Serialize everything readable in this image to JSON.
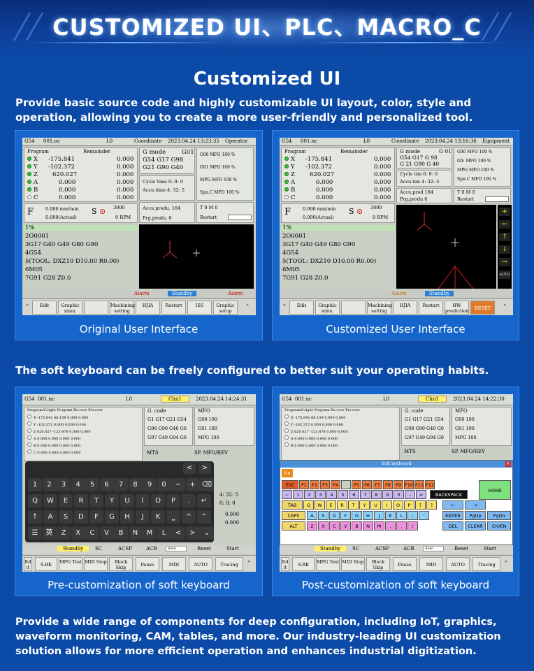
{
  "banner": {
    "title": "CUSTOMIZED UI、PLC、MACRO_C"
  },
  "section": {
    "title": "Customized UI",
    "intro": "Provide basic source code and highly customizable UI layout, color, style and operation, allowing you to create a more user-friendly and personalized tool.",
    "keyboard_text": "The soft keyboard can be freely configured to better suit your operating habits.",
    "outro": "Provide a wide range of components for deep configuration, including IoT, graphics, waveform monitoring, CAM, tables, and more. Our industry-leading UI customization solution allows for more efficient operation and enhances industrial digitization."
  },
  "cards": {
    "original": "Original User Interface",
    "customized": "Customized User Interface",
    "pre_kb": "Pre-customization of soft keyboard",
    "post_kb": "Post-customization of soft keyboard"
  },
  "screen1": {
    "top": {
      "g54": "G54",
      "file": "001.nc",
      "l0": "L0",
      "coord": "Coordinate",
      "date": "2023.04.24 13:23:35",
      "mode": "Operator"
    },
    "header": {
      "program": "Program",
      "remainder": "Remainder"
    },
    "axes": [
      {
        "name": "X",
        "val": "-175.841",
        "rem": "0.000"
      },
      {
        "name": "Y",
        "val": "-102.372",
        "rem": "0.000"
      },
      {
        "name": "Z",
        "val": "620.027",
        "rem": "0.000"
      },
      {
        "name": "A",
        "val": "0.000",
        "rem": "0.000"
      },
      {
        "name": "B",
        "val": "0.000",
        "rem": "0.000"
      },
      {
        "name": "C",
        "val": "0.000",
        "rem": "0.000"
      }
    ],
    "gmode": {
      "label": "G mode",
      "l1": "G01",
      "l2": "G54  G17  G98",
      "l3": "G21  G90  G40"
    },
    "mfo": [
      "G00 MFO  100 %",
      "G01 MFO  100 %",
      "MPG MFO  100 %",
      "Spn.C MFO  100 %"
    ],
    "cycle": "Cycle time   0: 0: 0",
    "accu": "Accu.time    4: 32: 5",
    "accu_prod": "Accu.produ.    184",
    "prg_prod": "Prg.produ.      0",
    "tmo": "T       0       M       0",
    "restart": "Restart",
    "feed": {
      "f": "F",
      "rate": "0.000 mm/min",
      "actual": "0.000(Actual)",
      "s": "S",
      "spd": "3000",
      "rpm": "0  RPM"
    },
    "program_lines": [
      "1%",
      "2O0001",
      "3G17 G40 G49 G80 G90",
      "4G54",
      "5(TOOL: DXZ10 D10.00 R0.00)",
      "6M05",
      "7G91 G28 Z0.0"
    ],
    "status": {
      "alarm1": "Alarm",
      "standby": "Standby",
      "alarm2": "Alarm"
    },
    "buttons": [
      "Edit",
      "Graphic simu.",
      "",
      "Machining setting",
      "HJIA",
      "Restart",
      "ISS",
      "Graphic setup"
    ]
  },
  "screen2": {
    "top": {
      "g54": "G54",
      "file": "001.nc",
      "l0": "L0",
      "coord": "Coordinate",
      "date": "2023.04.24 13:16:36",
      "mode": "Equipment"
    },
    "gmode": {
      "label": "G mode",
      "l1": "G 01",
      "l2": "G54  G17  G 98",
      "l3": "G 21  G90  G 40"
    },
    "mfo": [
      "G00 MFO  100 %",
      "G0: MFO  100 %",
      "MPG MFO  100 %",
      "Spn.C MFO  100 %"
    ],
    "cycle": "Cycle tim   0: 0: 0",
    "accu": "Accu.tim    4: 32: 5",
    "accu_prod": "Accu.prod     184",
    "prg_prod": "Prg.produ       0",
    "tmo": "T    0    M    0",
    "restart": "Restart",
    "status": {
      "alarm": "Alarm",
      "standby": "Standby"
    },
    "buttons": [
      "Edit",
      "Graphic simu.",
      "",
      "Machining setting",
      "HJIA",
      "Restart",
      "HW prediction",
      "RESET"
    ],
    "side_buttons": [
      "+",
      "←",
      "↑",
      "↓",
      "→",
      "AUTO"
    ]
  },
  "screen3": {
    "top": {
      "g54": "G54",
      "file": "001.nc",
      "l0": "L0",
      "chn": "Chn1",
      "date": "2023.04.24 14:24:31"
    },
    "header": "Program/G.light Program      Re.coor      Err.coor",
    "gcode": {
      "label": "G. code",
      "l1": "G1   G17  G21  G54",
      "l2": "G98  G90  G40  G0",
      "l3": "G97  G49  G94  G0"
    },
    "mfo": {
      "label": "MFO",
      "rows": [
        "G00      100",
        "G01      100",
        "MPG      100"
      ]
    },
    "mts": "MTS",
    "sp": "SP. MFO/REV",
    "keys_row1": [
      "1",
      "2",
      "3",
      "4",
      "5",
      "6",
      "7",
      "8",
      "9",
      "0",
      "−",
      "+",
      "⌫"
    ],
    "keys_row2": [
      "Q",
      "W",
      "E",
      "R",
      "T",
      "Y",
      "U",
      "I",
      "O",
      "P",
      ".",
      "↵"
    ],
    "keys_row3": [
      "↑",
      "A",
      "S",
      "D",
      "F",
      "G",
      "H",
      "J",
      "K",
      "⎵",
      "^",
      "⌃"
    ],
    "keys_row4": [
      "☰",
      "英",
      "Z",
      "X",
      "C",
      "V",
      "B",
      "N",
      "M",
      "L",
      "<",
      ">",
      "⌄"
    ],
    "status": [
      "Standby",
      "SC",
      "ACSP",
      "ACR",
      "Auto",
      "Reset",
      "Start"
    ],
    "buttons": [
      "Ed it",
      "S.BK",
      "MPG Test",
      "MDI Stop",
      "Block Skip",
      "Pause",
      "MDI",
      "AUTO",
      "Tracing"
    ]
  },
  "screen4": {
    "top": {
      "g54": "G54",
      "file": "001.nc",
      "l0": "L0",
      "chn": "Chn1",
      "date": "2023.04.24 14:22:30"
    },
    "title": "Soft keyboard",
    "indicator": "En",
    "fkeys": [
      "ESC",
      "F1",
      "F2",
      "F3",
      "F4",
      "",
      "F5",
      "F6",
      "F7",
      "F8",
      "F9",
      "F10",
      "F11",
      "F12"
    ],
    "special": {
      "backspace": "BACKSPACK",
      "home": "HOME",
      "tab": "TAB",
      "caps": "CAPS LOCK",
      "alt": "ALT",
      "enter": "ENTER",
      "pgup": "PgUp",
      "pgdn": "PgDn",
      "del": "DEL",
      "clear": "CLEAR",
      "chen": "CH/EN"
    },
    "row2": [
      "~",
      "1",
      "2",
      "3",
      "4",
      "5",
      "6",
      "7",
      "8",
      "9",
      "0",
      "-",
      "="
    ],
    "row3": [
      "Q",
      "W",
      "E",
      "R",
      "T",
      "Y",
      "U",
      "I",
      "O",
      "P",
      "[",
      "]"
    ],
    "row4": [
      "A",
      "S",
      "D",
      "F",
      "G",
      "H",
      "J",
      "K",
      "L",
      ";",
      "'"
    ],
    "row5": [
      "Z",
      "X",
      "C",
      "V",
      "B",
      "N",
      "M",
      ",",
      ".",
      "/"
    ],
    "status": [
      "Standby",
      "SC",
      "ACSP",
      "ACR",
      "Auto",
      "Reset",
      "Start"
    ],
    "buttons": [
      "Ed it",
      "S.BK",
      "MPG Test",
      "MDI Stop",
      "Block Skip",
      "Pause",
      "MDI",
      "AUTO",
      "Tracing"
    ]
  }
}
